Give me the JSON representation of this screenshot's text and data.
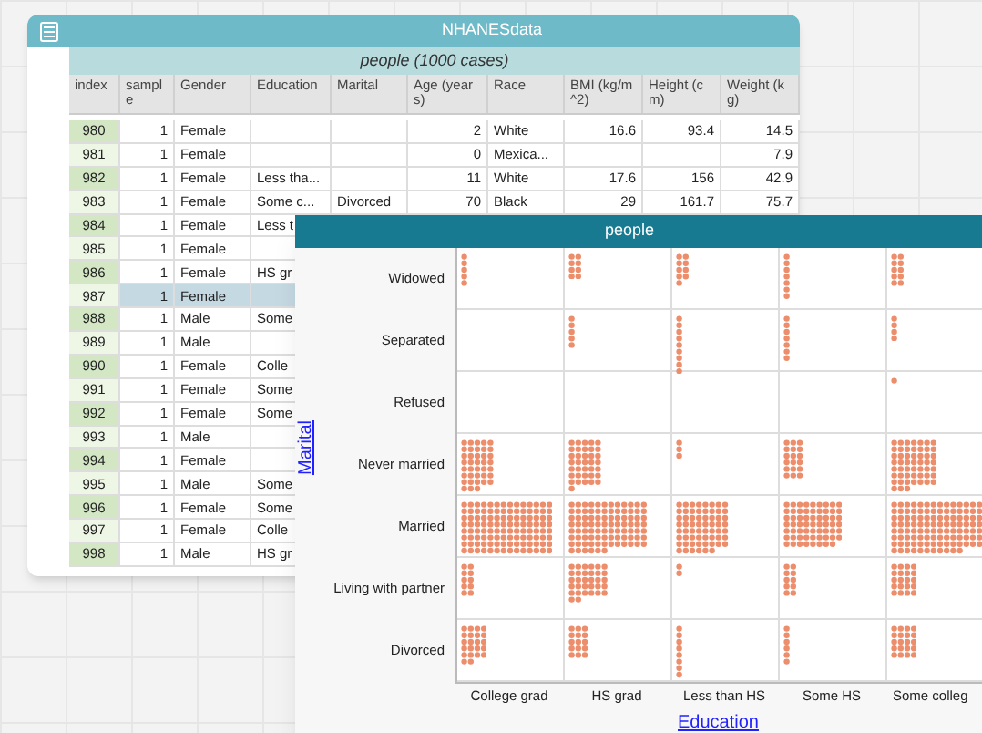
{
  "table_window": {
    "title": "NHANESdata",
    "collection": "people (1000 cases)",
    "columns": [
      "index",
      "sample",
      "Gender",
      "Education",
      "Marital",
      "Age (years)",
      "Race",
      "BMI (kg/m^2)",
      "Height (cm)",
      "Weight (kg)"
    ],
    "rows": [
      {
        "cells": [
          "980",
          "1",
          "Female",
          "",
          "",
          "2",
          "White",
          "16.6",
          "93.4",
          "14.5"
        ],
        "selected": false
      },
      {
        "cells": [
          "981",
          "1",
          "Female",
          "",
          "",
          "0",
          "Mexica...",
          "",
          "",
          "7.9"
        ],
        "selected": false
      },
      {
        "cells": [
          "982",
          "1",
          "Female",
          "Less tha...",
          "",
          "11",
          "White",
          "17.6",
          "156",
          "42.9"
        ],
        "selected": false
      },
      {
        "cells": [
          "983",
          "1",
          "Female",
          "Some c...",
          "Divorced",
          "70",
          "Black",
          "29",
          "161.7",
          "75.7"
        ],
        "selected": false
      },
      {
        "cells": [
          "984",
          "1",
          "Female",
          "Less t"
        ],
        "selected": false
      },
      {
        "cells": [
          "985",
          "1",
          "Female",
          ""
        ],
        "selected": false
      },
      {
        "cells": [
          "986",
          "1",
          "Female",
          "HS gr"
        ],
        "selected": false
      },
      {
        "cells": [
          "987",
          "1",
          "Female",
          ""
        ],
        "selected": true
      },
      {
        "cells": [
          "988",
          "1",
          "Male",
          "Some"
        ],
        "selected": false
      },
      {
        "cells": [
          "989",
          "1",
          "Male",
          ""
        ],
        "selected": false
      },
      {
        "cells": [
          "990",
          "1",
          "Female",
          "Colle"
        ],
        "selected": false
      },
      {
        "cells": [
          "991",
          "1",
          "Female",
          "Some"
        ],
        "selected": false
      },
      {
        "cells": [
          "992",
          "1",
          "Female",
          "Some"
        ],
        "selected": false
      },
      {
        "cells": [
          "993",
          "1",
          "Male",
          ""
        ],
        "selected": false
      },
      {
        "cells": [
          "994",
          "1",
          "Female",
          ""
        ],
        "selected": false
      },
      {
        "cells": [
          "995",
          "1",
          "Male",
          "Some"
        ],
        "selected": false
      },
      {
        "cells": [
          "996",
          "1",
          "Female",
          "Some"
        ],
        "selected": false
      },
      {
        "cells": [
          "997",
          "1",
          "Female",
          "Colle"
        ],
        "selected": false
      },
      {
        "cells": [
          "998",
          "1",
          "Male",
          "HS gr"
        ],
        "selected": false
      }
    ]
  },
  "plot_window": {
    "title": "people",
    "y_axis": {
      "label": "Marital",
      "categories": [
        "Widowed",
        "Separated",
        "Refused",
        "Never married",
        "Married",
        "Living with partner",
        "Divorced"
      ]
    },
    "x_axis": {
      "label": "Education",
      "categories": [
        "College grad",
        "HS grad",
        "Less than HS",
        "Some HS",
        "Some colleg"
      ]
    }
  }
}
